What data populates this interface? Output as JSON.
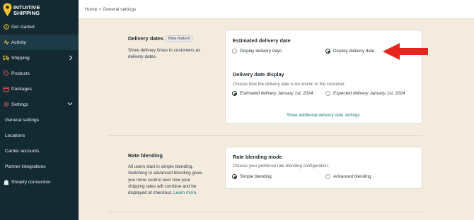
{
  "brand": {
    "line1": "INTUITIVE",
    "line2": "SHIPPING",
    "pin_color": "#f4c430"
  },
  "sidebar": {
    "items": [
      {
        "label": "Get started",
        "icon": "compass-icon"
      },
      {
        "label": "Activity",
        "icon": "activity-icon"
      },
      {
        "label": "Shipping",
        "icon": "truck-icon"
      },
      {
        "label": "Products",
        "icon": "tag-icon"
      },
      {
        "label": "Packages",
        "icon": "package-icon"
      },
      {
        "label": "Settings",
        "icon": "gear-icon"
      },
      {
        "label": "General settings"
      },
      {
        "label": "Locations"
      },
      {
        "label": "Carrier accounts"
      },
      {
        "label": "Partner integrations"
      },
      {
        "label": "Shopify connection",
        "icon": "shopify-icon"
      }
    ]
  },
  "breadcrumb": {
    "home": "Home",
    "separator": ">",
    "current": "General settings"
  },
  "delivery": {
    "title": "Delivery dates",
    "badge": "Beta feature",
    "description": "Show delivery times to customers as delivery dates.",
    "card": {
      "title": "Estimated delivery date",
      "option_days": "Display delivery days",
      "option_date": "Display delivery date",
      "selected": "date",
      "display_title": "Delivery date display",
      "display_sub": "Choose how the delivery date is be shown to the customer.",
      "option_estimated": "Estimated delivery January 1st, 2024",
      "option_expected": "Expected delivery January 1st, 2024",
      "display_selected": "estimated",
      "link": "Show additional delivery date settings"
    }
  },
  "rate": {
    "title": "Rate blending",
    "description": "All users start in simple blending. Switching to advanced blending gives you more control over how your shipping rates will combine and be displayed at checkout.",
    "learn_more": "Learn more",
    "card": {
      "title": "Rate blending mode",
      "sub": "Choose your preferred rate blending configuration.",
      "option_simple": "Simple blending",
      "option_advanced": "Advanced blending",
      "selected": "simple"
    }
  },
  "colors": {
    "sidebar_bg": "#142a33",
    "page_bg": "#f3ebdd",
    "accent_link": "#1a7a83",
    "arrow": "#e8251c"
  }
}
